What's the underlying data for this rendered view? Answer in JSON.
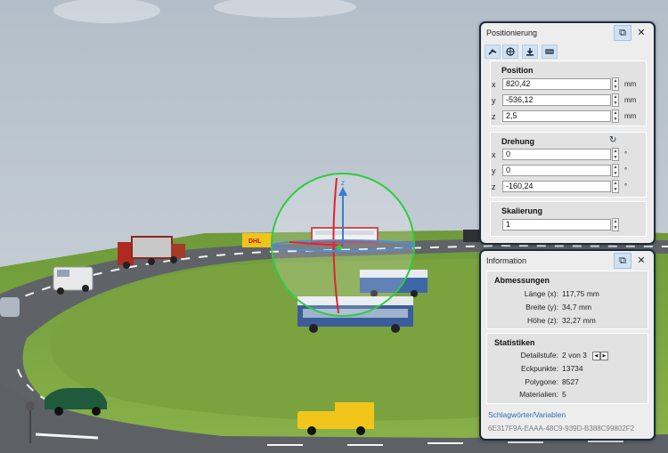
{
  "positioning": {
    "title": "Positionierung",
    "toolbar_icons": [
      "transform-icon",
      "globe-icon",
      "drop-to-ground-icon",
      "grid-icon"
    ],
    "position": {
      "heading": "Position",
      "x_label": "x",
      "x_value": "820,42",
      "x_unit": "mm",
      "y_label": "y",
      "y_value": "-536,12",
      "y_unit": "mm",
      "z_label": "z",
      "z_value": "2,5",
      "z_unit": "mm"
    },
    "rotation": {
      "heading": "Drehung",
      "x_label": "x",
      "x_value": "0",
      "x_unit": "°",
      "y_label": "y",
      "y_value": "0",
      "y_unit": "°",
      "z_label": "z",
      "z_value": "-160,24",
      "z_unit": "°"
    },
    "scale": {
      "heading": "Skalierung",
      "value": "1"
    }
  },
  "information": {
    "title": "Information",
    "dimensions": {
      "heading": "Abmessungen",
      "length_label": "Länge (x):",
      "length_value": "117,75 mm",
      "width_label": "Breite (y):",
      "width_value": "34,7 mm",
      "height_label": "Höhe (z):",
      "height_value": "32,27 mm"
    },
    "statistics": {
      "heading": "Statistiken",
      "detail_label": "Detailstufe:",
      "detail_value": "2 von 3",
      "vertices_label": "Eckpunkte:",
      "vertices_value": "13734",
      "polygons_label": "Polygone:",
      "polygons_value": "8527",
      "materials_label": "Materialien:",
      "materials_value": "5"
    },
    "keywords_link": "Schlagwörter/Variablen",
    "guid": "6E317F9A-EAAA-48C9-939D-B388C99802F2"
  },
  "scene": {
    "gizmo_axis_label": "z",
    "vehicle_text": "DHL",
    "colors": {
      "sky": "#b9c3cd",
      "grass": "#7ea341",
      "road": "#5d6166",
      "bus": "#3b5d99",
      "selection_ring": "#2ecc40"
    }
  }
}
